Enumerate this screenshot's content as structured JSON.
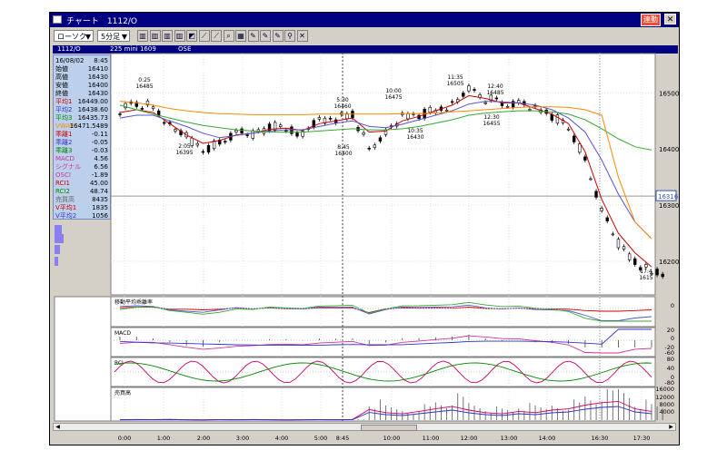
{
  "window": {
    "title": "チャート　1112/O",
    "renkou_label": "連動",
    "close_label": "✕"
  },
  "toolbar": {
    "chart_type": "ローソク",
    "interval": "5分足",
    "buttons": [
      "bar",
      "bar",
      "bar",
      "bar",
      "mark",
      "line",
      "line",
      "zoom",
      "fill",
      "edit",
      "edit",
      "edit",
      "search",
      "cross"
    ]
  },
  "infobar": {
    "code": "1112/O",
    "name": "225 mini 1609",
    "market": "OSE"
  },
  "data_panel": [
    {
      "k": "16/08/02",
      "v": "8:45",
      "c": "#000"
    },
    {
      "k": "始値",
      "v": "16410",
      "c": "#000"
    },
    {
      "k": "高値",
      "v": "16430",
      "c": "#000"
    },
    {
      "k": "安値",
      "v": "16400",
      "c": "#000"
    },
    {
      "k": "終値",
      "v": "16430",
      "c": "#000"
    },
    {
      "k": "平均1",
      "v": "16449.00",
      "c": "#cc0000"
    },
    {
      "k": "平均2",
      "v": "16438.60",
      "c": "#3333cc"
    },
    {
      "k": "平均3",
      "v": "16435.73",
      "c": "#008800"
    },
    {
      "k": "VWAP",
      "v": "16471.5489",
      "c": "#ff8800"
    },
    {
      "k": "乖離1",
      "v": "-0.11",
      "c": "#cc0000"
    },
    {
      "k": "乖離2",
      "v": "-0.05",
      "c": "#3333cc"
    },
    {
      "k": "乖離3",
      "v": "-0.03",
      "c": "#008800"
    },
    {
      "k": "MACD",
      "v": "4.56",
      "c": "#cc3399"
    },
    {
      "k": "シグナル",
      "v": "6.56",
      "c": "#cc3399"
    },
    {
      "k": "OSCI",
      "v": "-1.89",
      "c": "#cc3399"
    },
    {
      "k": "RCI1",
      "v": "45.00",
      "c": "#cc0000"
    },
    {
      "k": "RCI2",
      "v": "48.74",
      "c": "#008800"
    },
    {
      "k": "売買高",
      "v": "8435",
      "c": "#666"
    },
    {
      "k": "V平均1",
      "v": "1835",
      "c": "#cc0000"
    },
    {
      "k": "V平均2",
      "v": "1056",
      "c": "#3333cc"
    }
  ],
  "price_axis": [
    "16500",
    "16400",
    "16300",
    "16200"
  ],
  "current_price": "16316",
  "time_axis": [
    "0:00",
    "1:00",
    "2:00",
    "3:00",
    "4:00",
    "5:00",
    "8:45",
    "10:00",
    "11:00",
    "12:00",
    "13:00",
    "14:00",
    "16:30",
    "17:30"
  ],
  "annotations": [
    {
      "t": "0:25",
      "p": "16485"
    },
    {
      "t": "2:05",
      "p": "16395"
    },
    {
      "t": "5:30",
      "p": "16460"
    },
    {
      "t": "8:45",
      "p": "16400"
    },
    {
      "t": "10:00",
      "p": "16475"
    },
    {
      "t": "10:35",
      "p": "16430"
    },
    {
      "t": "11:35",
      "p": "16505"
    },
    {
      "t": "12:40",
      "p": "16485"
    },
    {
      "t": "12:30",
      "p": "16455"
    },
    {
      "t": "17:4",
      "p": "1615"
    }
  ],
  "panels": {
    "kairi": {
      "label": "移動平均乖離率",
      "axis": [
        "0"
      ]
    },
    "macd": {
      "label": "MACD",
      "axis": [
        "20",
        "0",
        "-20",
        "-60"
      ]
    },
    "rci": {
      "label": "RCI",
      "axis": [
        "80",
        "40",
        "0",
        "-80"
      ]
    },
    "volume": {
      "label": "売買高",
      "axis": [
        "16000",
        "12000",
        "8000",
        "4000"
      ]
    }
  },
  "chart_data": {
    "type": "line",
    "title": "225 mini 1609 5分足",
    "xlabel": "",
    "ylabel": "",
    "x_ticks": [
      "0:00",
      "1:00",
      "2:00",
      "3:00",
      "4:00",
      "5:00",
      "8:45",
      "10:00",
      "11:00",
      "12:00",
      "13:00",
      "14:00",
      "16:30",
      "17:30"
    ],
    "ylim": [
      16140,
      16570
    ],
    "series": [
      {
        "name": "終値",
        "color": "#000000",
        "values": [
          16470,
          16480,
          16475,
          16440,
          16420,
          16400,
          16410,
          16430,
          16425,
          16440,
          16435,
          16430,
          16450,
          16455,
          16460,
          16400,
          16430,
          16455,
          16460,
          16470,
          16480,
          16505,
          16490,
          16480,
          16485,
          16470,
          16460,
          16440,
          16380,
          16290,
          16230,
          16200,
          16180
        ]
      },
      {
        "name": "平均1",
        "color": "#cc0000",
        "values": [
          16465,
          16470,
          16465,
          16445,
          16425,
          16410,
          16415,
          16425,
          16428,
          16435,
          16437,
          16433,
          16445,
          16450,
          16455,
          16430,
          16432,
          16450,
          16458,
          16468,
          16478,
          16495,
          16490,
          16482,
          16482,
          16472,
          16462,
          16445,
          16395,
          16310,
          16250,
          16215,
          16190
        ]
      },
      {
        "name": "平均2",
        "color": "#5555cc",
        "values": [
          16455,
          16460,
          16460,
          16450,
          16440,
          16428,
          16420,
          16424,
          16428,
          16432,
          16434,
          16434,
          16440,
          16446,
          16450,
          16440,
          16438,
          16444,
          16452,
          16460,
          16468,
          16480,
          16485,
          16484,
          16482,
          16478,
          16470,
          16455,
          16430,
          16380,
          16320,
          16270,
          16240
        ]
      },
      {
        "name": "平均3",
        "color": "#33aa33",
        "values": [
          16478,
          16470,
          16462,
          16455,
          16448,
          16442,
          16438,
          16434,
          16432,
          16430,
          16430,
          16430,
          16432,
          16434,
          16436,
          16434,
          16434,
          16436,
          16440,
          16446,
          16452,
          16460,
          16464,
          16466,
          16468,
          16468,
          16466,
          16462,
          16452,
          16436,
          16418,
          16404,
          16398
        ]
      },
      {
        "name": "VWAP",
        "color": "#ff8800",
        "values": [
          16485,
          16482,
          16478,
          16472,
          16468,
          16465,
          16463,
          16462,
          16461,
          16461,
          16461,
          16461,
          16462,
          16462,
          16462,
          16462,
          16462,
          16463,
          16463,
          16464,
          16466,
          16468,
          16470,
          16472,
          16474,
          16475,
          16475,
          16474,
          16470,
          16460,
          16350,
          16270,
          16240
        ]
      }
    ],
    "volume": [
      300,
      500,
      400,
      600,
      300,
      200,
      400,
      300,
      500,
      300,
      200,
      300,
      400,
      300,
      500,
      8435,
      6000,
      5000,
      7000,
      9000,
      11000,
      8000,
      6000,
      5000,
      7000,
      6000,
      8000,
      9000,
      12000,
      14000,
      15000,
      9000,
      7000
    ]
  }
}
